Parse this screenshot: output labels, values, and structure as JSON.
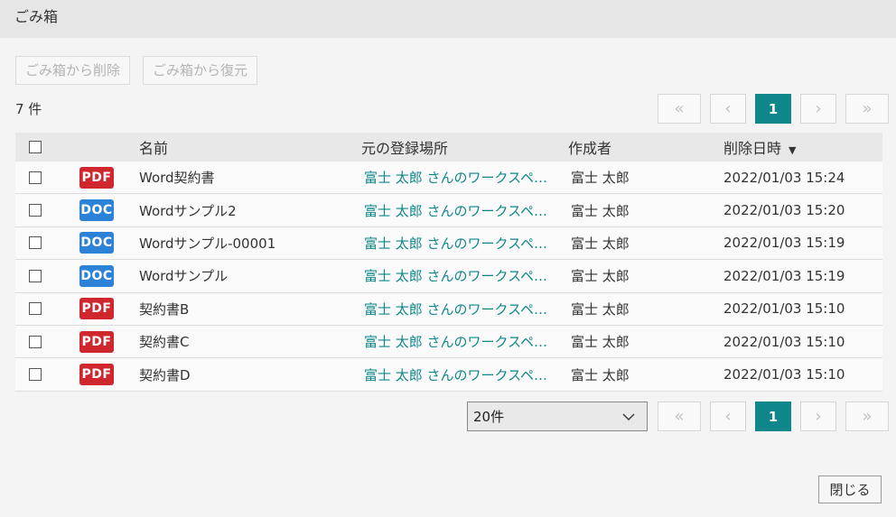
{
  "window": {
    "title": "ごみ箱"
  },
  "toolbar": {
    "delete_label": "ごみ箱から削除",
    "restore_label": "ごみ箱から復元"
  },
  "summary": {
    "count_text": "7 件"
  },
  "pager": {
    "first": "«",
    "prev": "‹",
    "page": "1",
    "next": "›",
    "last": "»"
  },
  "table": {
    "headers": {
      "name": "名前",
      "location": "元の登録場所",
      "author": "作成者",
      "deleted_at": "削除日時",
      "sort_indicator": "▼"
    },
    "rows": [
      {
        "type": "PDF",
        "name": "Word契約書",
        "location": "富士 太郎 さんのワークスペース",
        "author": "富士 太郎",
        "deleted_at": "2022/01/03 15:24"
      },
      {
        "type": "DOC",
        "name": "Wordサンプル2",
        "location": "富士 太郎 さんのワークスペース",
        "author": "富士 太郎",
        "deleted_at": "2022/01/03 15:20"
      },
      {
        "type": "DOC",
        "name": "Wordサンプル-00001",
        "location": "富士 太郎 さんのワークスペース",
        "author": "富士 太郎",
        "deleted_at": "2022/01/03 15:19"
      },
      {
        "type": "DOC",
        "name": "Wordサンプル",
        "location": "富士 太郎 さんのワークスペース",
        "author": "富士 太郎",
        "deleted_at": "2022/01/03 15:19"
      },
      {
        "type": "PDF",
        "name": "契約書B",
        "location": "富士 太郎 さんのワークスペース",
        "author": "富士 太郎",
        "deleted_at": "2022/01/03 15:10"
      },
      {
        "type": "PDF",
        "name": "契約書C",
        "location": "富士 太郎 さんのワークスペース",
        "author": "富士 太郎",
        "deleted_at": "2022/01/03 15:10"
      },
      {
        "type": "PDF",
        "name": "契約書D",
        "location": "富士 太郎 さんのワークスペース",
        "author": "富士 太郎",
        "deleted_at": "2022/01/03 15:10"
      }
    ]
  },
  "page_size": {
    "selected": "20件"
  },
  "footer": {
    "close_label": "閉じる"
  },
  "colors": {
    "accent": "#0f878a",
    "pdf": "#d0262e",
    "doc": "#2c82d6"
  }
}
